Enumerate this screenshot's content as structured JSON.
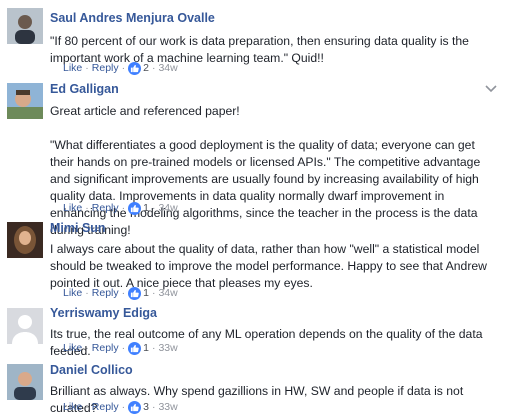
{
  "comments": [
    {
      "author": "Saul Andres Menjura Ovalle",
      "text": "\"If 80 percent of our work is data preparation, then ensuring data quality is the important work of a machine learning team.\" Quid!!",
      "like_label": "Like",
      "reply_label": "Reply",
      "reaction_count": "2",
      "time": "34w"
    },
    {
      "author": "Ed Galligan",
      "text": "Great article and referenced paper!\n\n\"What differentiates a good deployment is the quality of data; everyone can get their hands on pre-trained models or licensed APIs.\" The competitive advantage and significant improvements are usually found by increasing availability of high quality data. Improvements in data quality normally dwarf improvement in enhancing the modeling algorithms, since the teacher in the process is the data during training!",
      "like_label": "Like",
      "reply_label": "Reply",
      "reaction_count": "1",
      "time": "34w"
    },
    {
      "author": "Mimi Sun",
      "text": "I always care about the quality of data, rather than how \"well\" a statistical model should be tweaked to improve the model performance. Happy to see that Andrew pointed it out. A nice piece that pleases my eyes.",
      "like_label": "Like",
      "reply_label": "Reply",
      "reaction_count": "1",
      "time": "34w"
    },
    {
      "author": "Yerriswamy Ediga",
      "text": "Its true, the real outcome of any ML operation depends on the quality of the data feeded.",
      "like_label": "Like",
      "reply_label": "Reply",
      "reaction_count": "1",
      "time": "33w"
    },
    {
      "author": "Daniel Collico",
      "text": "Brilliant as always. Why spend gazillions in HW, SW and people if data is not curated?",
      "like_label": "Like",
      "reply_label": "Reply",
      "reaction_count": "3",
      "time": "33w"
    }
  ],
  "colors": {
    "author": "#365899",
    "like_badge": "#4080ff",
    "meta": "#90949c"
  },
  "icons": {
    "reaction": "thumbs-up-icon",
    "reply": "reply-arrow-icon",
    "menu": "chevron-down-icon"
  }
}
